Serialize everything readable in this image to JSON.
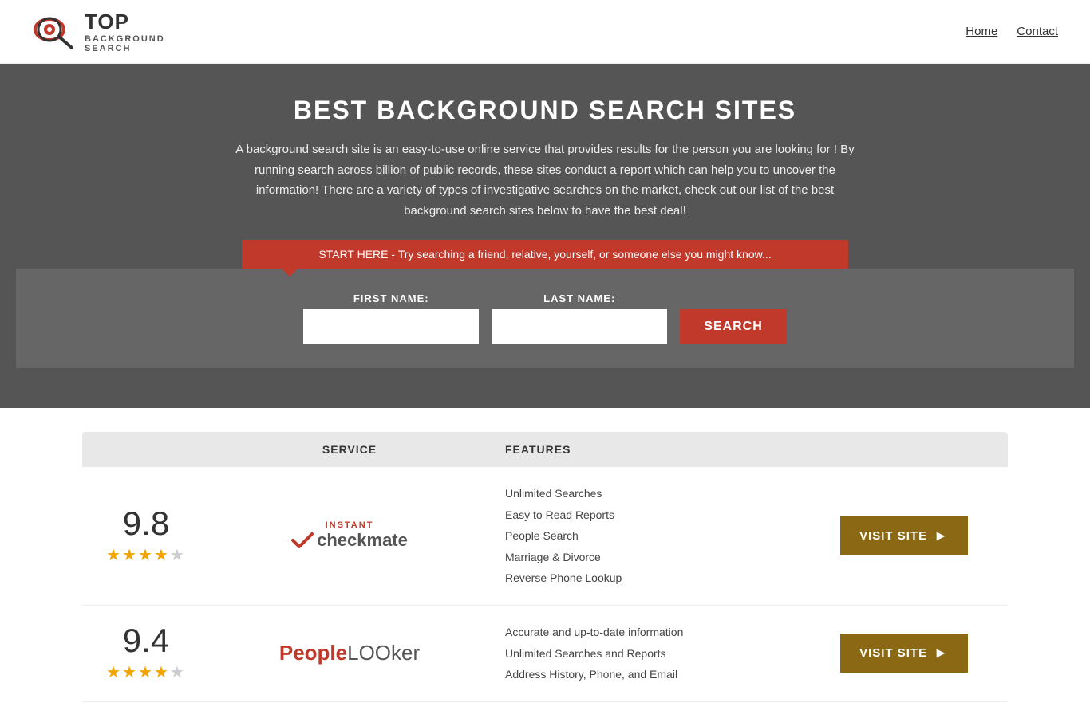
{
  "header": {
    "logo_top": "TOP",
    "logo_sub": "BACKGROUND\nSEARCH",
    "nav": [
      {
        "label": "Home",
        "href": "#"
      },
      {
        "label": "Contact",
        "href": "#"
      }
    ]
  },
  "hero": {
    "title": "BEST BACKGROUND SEARCH SITES",
    "description": "A background search site is an easy-to-use online service that provides results  for the person you are looking for ! By  running  search across billion of public records, these sites conduct  a report which can help you to uncover the information! There are a variety of types of investigative searches on the market, check out our  list of the best background search sites below to have the best deal!",
    "tooltip_text": "START HERE - Try searching a friend, relative, yourself, or someone else you might know..."
  },
  "search_form": {
    "first_name_label": "FIRST NAME:",
    "last_name_label": "LAST NAME:",
    "first_name_placeholder": "",
    "last_name_placeholder": "",
    "search_button_label": "SEARCH"
  },
  "table": {
    "headers": {
      "col1": "",
      "col2": "SERVICE",
      "col3": "FEATURES",
      "col4": ""
    },
    "rows": [
      {
        "score": "9.8",
        "stars": "★★★★★",
        "service_name": "Instant Checkmate",
        "features": [
          "Unlimited Searches",
          "Easy to Read Reports",
          "People Search",
          "Marriage & Divorce",
          "Reverse Phone Lookup"
        ],
        "visit_label": "VISIT SITE"
      },
      {
        "score": "9.4",
        "stars": "★★★★★",
        "service_name": "PeopleLooker",
        "features": [
          "Accurate and up-to-date information",
          "Unlimited Searches and Reports",
          "Address History, Phone, and Email"
        ],
        "visit_label": "VISIT SITE"
      }
    ]
  }
}
